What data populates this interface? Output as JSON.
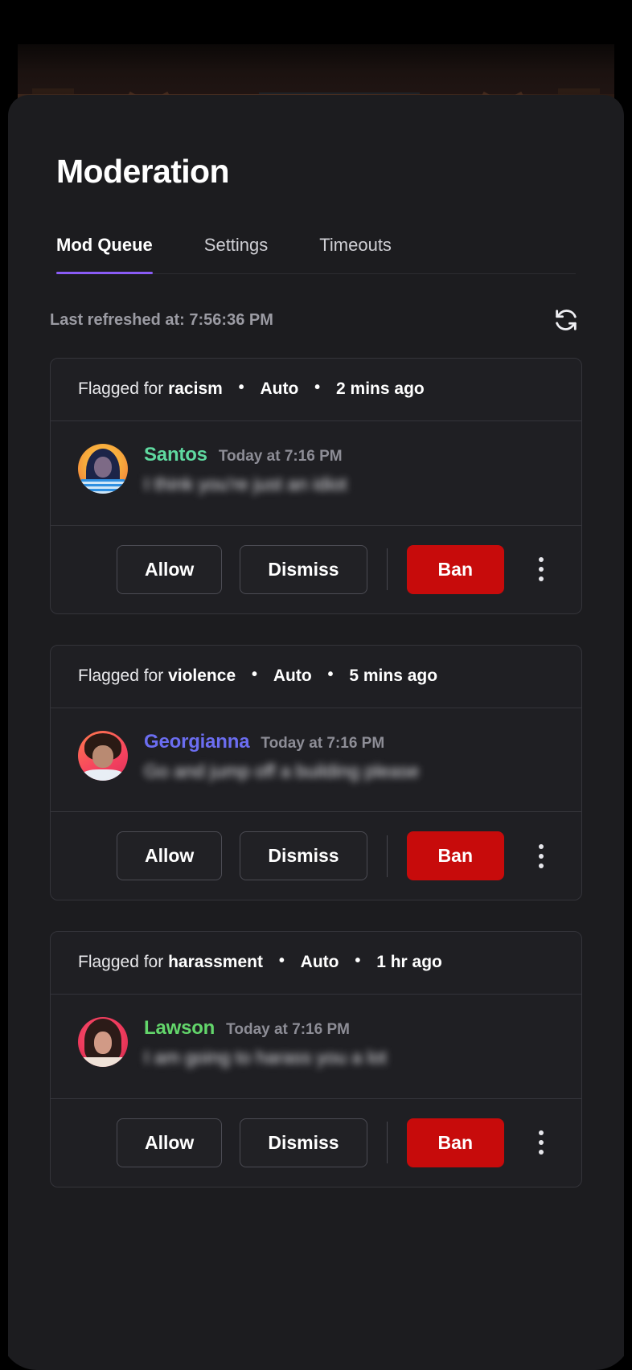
{
  "header": {
    "title": "Moderation"
  },
  "tabs": [
    {
      "label": "Mod Queue",
      "active": true
    },
    {
      "label": "Settings",
      "active": false
    },
    {
      "label": "Timeouts",
      "active": false
    }
  ],
  "refresh": {
    "label": "Last refreshed at: 7:56:36 PM",
    "icon": "refresh-icon"
  },
  "actions": {
    "allow": "Allow",
    "dismiss": "Dismiss",
    "ban": "Ban",
    "more": "more-options-icon"
  },
  "colors": {
    "accent": "#8a5cf6",
    "danger": "#c70b0b",
    "sheet_bg": "#1c1c1f",
    "card_bg": "#1f1f23",
    "card_border": "#34343a",
    "muted_text": "#9b9ba3"
  },
  "queue": [
    {
      "flagged_prefix": "Flagged for",
      "reason": "racism",
      "source": "Auto",
      "age": "2 mins ago",
      "author": "Santos",
      "author_color": "#5fd9a0",
      "timestamp": "Today at 7:16 PM",
      "message": "I think you're just an idiot"
    },
    {
      "flagged_prefix": "Flagged for",
      "reason": "violence",
      "source": "Auto",
      "age": "5 mins ago",
      "author": "Georgianna",
      "author_color": "#6b6df0",
      "timestamp": "Today at 7:16 PM",
      "message": "Go and jump off a building please"
    },
    {
      "flagged_prefix": "Flagged for",
      "reason": "harassment",
      "source": "Auto",
      "age": "1 hr ago",
      "author": "Lawson",
      "author_color": "#63d66b",
      "timestamp": "Today at 7:16 PM",
      "message": "I am going to harass you a lot"
    }
  ]
}
